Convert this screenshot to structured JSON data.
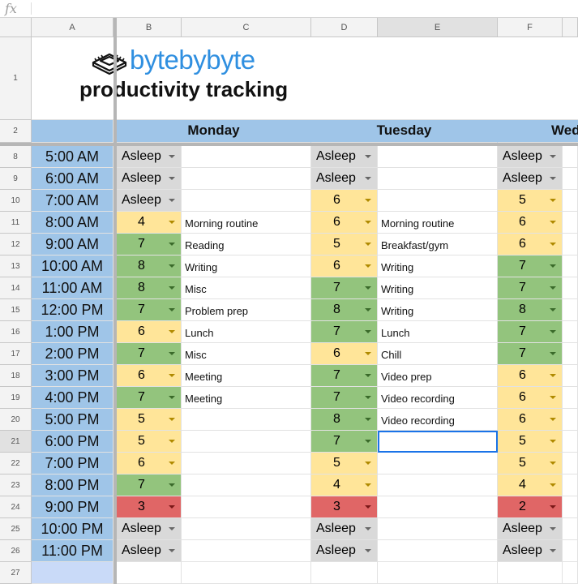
{
  "formula_bar": {
    "fx_label": "fx"
  },
  "columns": [
    "A",
    "B",
    "C",
    "D",
    "E",
    "F"
  ],
  "selected_column": "E",
  "title": {
    "brand": "bytebybyte",
    "subtitle": "productivity tracking"
  },
  "days": [
    "Monday",
    "Tuesday",
    "Wed"
  ],
  "row_labels": [
    "1",
    "2",
    "8",
    "9",
    "10",
    "11",
    "12",
    "13",
    "14",
    "15",
    "16",
    "17",
    "18",
    "19",
    "20",
    "21",
    "22",
    "23",
    "24",
    "25",
    "26",
    "27"
  ],
  "selected_row": "21",
  "times": [
    "5:00 AM",
    "6:00 AM",
    "7:00 AM",
    "8:00 AM",
    "9:00 AM",
    "10:00 AM",
    "11:00 AM",
    "12:00 PM",
    "1:00 PM",
    "2:00 PM",
    "3:00 PM",
    "4:00 PM",
    "5:00 PM",
    "6:00 PM",
    "7:00 PM",
    "8:00 PM",
    "9:00 PM",
    "10:00 PM",
    "11:00 PM"
  ],
  "colors": {
    "green": "#93c47d",
    "yellow": "#ffe599",
    "red": "#e06666",
    "gray": "#d9d9d9",
    "blue": "#9fc5e8"
  },
  "monday": {
    "ratings": [
      "Asleep",
      "Asleep",
      "Asleep",
      "4",
      "7",
      "8",
      "8",
      "7",
      "6",
      "7",
      "6",
      "7",
      "5",
      "5",
      "6",
      "7",
      "3",
      "Asleep",
      "Asleep"
    ],
    "activities": [
      "",
      "",
      "",
      "Morning routine",
      "Reading",
      "Writing",
      "Misc",
      "Problem prep",
      "Lunch",
      "Misc",
      "Meeting",
      "Meeting",
      "",
      "",
      "",
      "",
      "",
      "",
      ""
    ]
  },
  "tuesday": {
    "ratings": [
      "Asleep",
      "Asleep",
      "6",
      "6",
      "5",
      "6",
      "7",
      "8",
      "7",
      "6",
      "7",
      "7",
      "8",
      "7",
      "5",
      "4",
      "3",
      "Asleep",
      "Asleep"
    ],
    "activities": [
      "",
      "",
      "",
      "Morning routine",
      "Breakfast/gym",
      "Writing",
      "Writing",
      "Writing",
      "Lunch",
      "Chill",
      "Video prep",
      "Video recording",
      "Video recording",
      "",
      "",
      "",
      "",
      "",
      ""
    ]
  },
  "wednesday": {
    "ratings": [
      "Asleep",
      "Asleep",
      "5",
      "6",
      "6",
      "7",
      "7",
      "8",
      "7",
      "7",
      "6",
      "6",
      "6",
      "5",
      "5",
      "4",
      "2",
      "Asleep",
      "Asleep"
    ]
  }
}
